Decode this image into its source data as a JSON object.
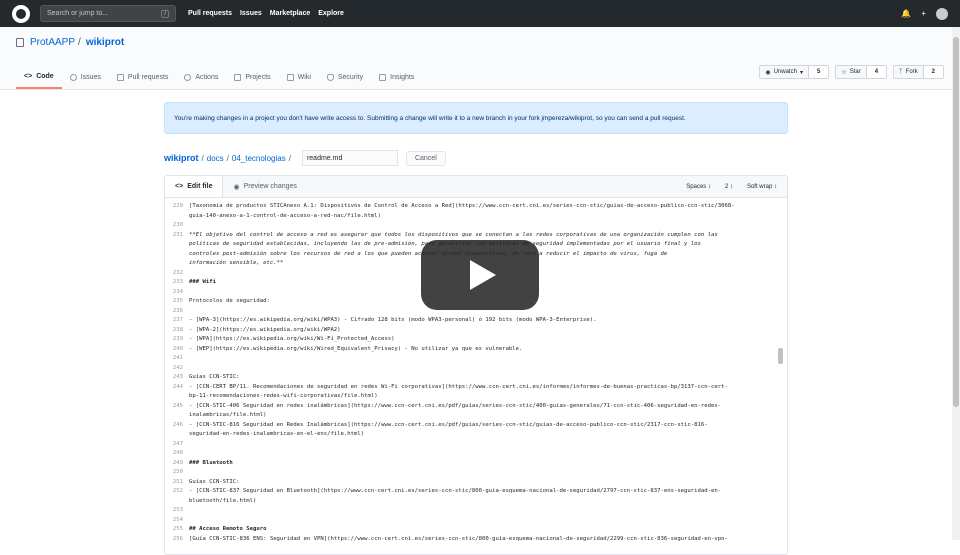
{
  "topbar": {
    "search_placeholder": "Search or jump to...",
    "search_shortcut": "/",
    "nav": [
      "Pull requests",
      "Issues",
      "Marketplace",
      "Explore"
    ],
    "bell_icon": "bell-icon",
    "plus_icon": "+",
    "avatar_icon": "avatar-icon"
  },
  "repo": {
    "owner": "ProtAAPP",
    "sep": "/",
    "name": "wikiprot",
    "actions": [
      {
        "label": "Unwatch",
        "count": "5",
        "icon": "eye-icon"
      },
      {
        "label": "Star",
        "count": "4",
        "icon": "star-icon"
      },
      {
        "label": "Fork",
        "count": "2",
        "icon": "fork-icon"
      }
    ],
    "tabs": [
      {
        "label": "Code",
        "icon": "code-icon",
        "active": true
      },
      {
        "label": "Issues",
        "icon": "issue-icon"
      },
      {
        "label": "Pull requests",
        "icon": "pull-request-icon"
      },
      {
        "label": "Actions",
        "icon": "play-icon"
      },
      {
        "label": "Projects",
        "icon": "project-icon"
      },
      {
        "label": "Wiki",
        "icon": "book-icon"
      },
      {
        "label": "Security",
        "icon": "shield-icon"
      },
      {
        "label": "Insights",
        "icon": "graph-icon"
      }
    ]
  },
  "flash": "You're making changes in a project you don't have write access to. Submitting a change will write it to a new branch in your fork jmpereza/wikiprot, so you can send a pull request.",
  "breadcrumb": {
    "root": "wikiprot",
    "parts": [
      "docs",
      "04_tecnologias"
    ],
    "filename": "readme.md",
    "cancel": "Cancel"
  },
  "editor": {
    "tab_edit": "Edit file",
    "tab_preview": "Preview changes",
    "indent_mode": "Spaces",
    "indent_size": "2",
    "wrap_mode": "Soft wrap",
    "lines": [
      {
        "n": "229",
        "t": "[Taxonomía de productos STICAnexo A.1: Dispositivos de Control de Acceso a Red](https://www.ccn-cert.cni.es/series-ccn-stic/guias-de-acceso-publico-ccn-stic/3068-"
      },
      {
        "n": "",
        "t": "guia-140-anexo-a-1-control-de-acceso-a-red-nac/file.html)"
      },
      {
        "n": "230",
        "t": ""
      },
      {
        "n": "231",
        "t": "**El objetivo del control de acceso a red es asegurar que todos los dispositivos que se conectan a las redes corporativas de una organización cumplen con las",
        "s": "it"
      },
      {
        "n": "",
        "t": "políticas de seguridad establecidas, incluyendo las de pre-admisión, para garantizar las políticas de seguridad implementadas por el usuario final y los",
        "s": "it"
      },
      {
        "n": "",
        "t": "controles post-admisión sobre los recursos de red a los que pueden acceder dichos dispositivos, de cara a reducir el impacto de virus, fuga de",
        "s": "it"
      },
      {
        "n": "",
        "t": "información sensible, etc.**",
        "s": "it"
      },
      {
        "n": "232",
        "t": ""
      },
      {
        "n": "233",
        "t": "### Wifi",
        "s": "b"
      },
      {
        "n": "234",
        "t": ""
      },
      {
        "n": "235",
        "t": "Protocolos de seguridad:"
      },
      {
        "n": "236",
        "t": ""
      },
      {
        "n": "237",
        "t": "- [WPA-3](https://es.wikipedia.org/wiki/WPA3) - Cifrado 128 bits (modo WPA3-personal) ó 192 bits (modo WPA-3-Enterprise)."
      },
      {
        "n": "238",
        "t": "- [WPA-2](https://es.wikipedia.org/wiki/WPA2)"
      },
      {
        "n": "239",
        "t": "- [WPA](https://es.wikipedia.org/wiki/Wi-Fi_Protected_Access)"
      },
      {
        "n": "240",
        "t": "- [WEP](https://es.wikipedia.org/wiki/Wired_Equivalent_Privacy) - No utilizar ya que es vulnerable."
      },
      {
        "n": "241",
        "t": ""
      },
      {
        "n": "242",
        "t": ""
      },
      {
        "n": "243",
        "t": "Guías CCN-STIC:"
      },
      {
        "n": "244",
        "t": "- [CCN-CERT BP/11. Recomendaciones de seguridad en redes Wi-Fi corporativas](https://www.ccn-cert.cni.es/informes/informes-de-buenas-practicas-bp/3137-ccn-cert-"
      },
      {
        "n": "",
        "t": "bp-11-recomendaciones-redes-wifi-corporativas/file.html)"
      },
      {
        "n": "245",
        "t": "- [CCN-STIC-406 Seguridad en redes inalámbricas](https://www.ccn-cert.cni.es/pdf/guias/series-ccn-stic/400-guias-generales/71-ccn-stic-406-seguridad-en-redes-"
      },
      {
        "n": "",
        "t": "inalambricas/file.html)"
      },
      {
        "n": "246",
        "t": "- [CCN-STIC-816 Seguridad en Redes Inalámbricas](https://www.ccn-cert.cni.es/pdf/guias/series-ccn-stic/guias-de-acceso-publico-ccn-stic/2317-ccn-stic-816-"
      },
      {
        "n": "",
        "t": "seguridad-en-redes-inalambricas-en-el-ens/file.html)"
      },
      {
        "n": "247",
        "t": ""
      },
      {
        "n": "248",
        "t": ""
      },
      {
        "n": "249",
        "t": "### Bluetooth",
        "s": "b"
      },
      {
        "n": "250",
        "t": ""
      },
      {
        "n": "251",
        "t": "Guías CCN-STIC:"
      },
      {
        "n": "252",
        "t": "- [CCN-STIC-837 Seguridad en Bluetooth](https://www.ccn-cert.cni.es/series-ccn-stic/800-guia-esquema-nacional-de-seguridad/2797-ccn-stic-837-ens-seguridad-en-"
      },
      {
        "n": "",
        "t": "bluetooth/file.html)"
      },
      {
        "n": "253",
        "t": ""
      },
      {
        "n": "254",
        "t": ""
      },
      {
        "n": "255",
        "t": "## Acceso Remoto Seguro",
        "s": "b"
      },
      {
        "n": "256",
        "t": "[Guía CCN-STIC-836 ENS: Seguridad en VPN](https://www.ccn-cert.cni.es/series-ccn-stic/800-guia-esquema-nacional-de-seguridad/2299-ccn-stic-836-seguridad-en-vpn-"
      }
    ]
  },
  "video_overlay": {
    "icon": "play-icon",
    "color": "#212121"
  }
}
